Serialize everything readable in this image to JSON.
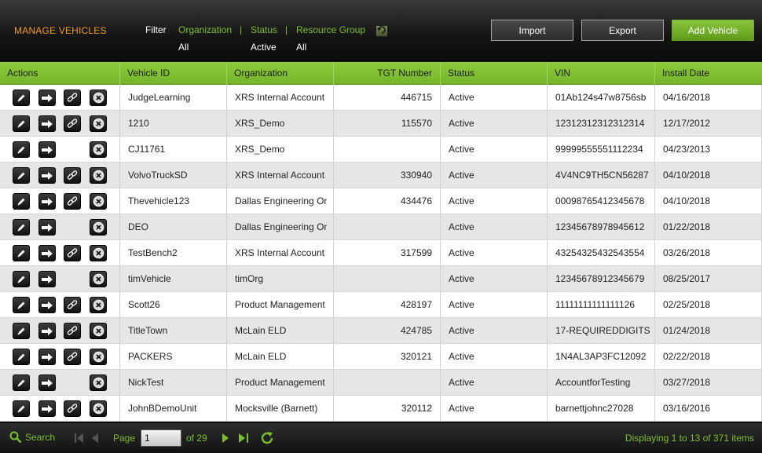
{
  "header": {
    "title": "MANAGE VEHICLES",
    "filter_label": "Filter",
    "filters": [
      {
        "label": "Organization",
        "value": "All"
      },
      {
        "label": "Status",
        "value": "Active"
      },
      {
        "label": "Resource Group",
        "value": "All"
      }
    ],
    "separator": "|",
    "buttons": {
      "import": "Import",
      "export": "Export",
      "add": "Add Vehicle"
    }
  },
  "table": {
    "columns": [
      "Actions",
      "Vehicle ID",
      "Organization",
      "TGT Number",
      "Status",
      "VIN",
      "Install Date"
    ],
    "rows": [
      {
        "vehicle_id": "JudgeLearning",
        "organization": "XRS Internal Account",
        "tgt": "446715",
        "status": "Active",
        "vin": "01Ab124s47w8756sb",
        "install_date": "04/16/2018",
        "has_link": true
      },
      {
        "vehicle_id": "1210",
        "organization": "XRS_Demo",
        "tgt": "115570",
        "status": "Active",
        "vin": "12312312312312314",
        "install_date": "12/17/2012",
        "has_link": true
      },
      {
        "vehicle_id": "CJ11761",
        "organization": "XRS_Demo",
        "tgt": "",
        "status": "Active",
        "vin": "99999555551112234",
        "install_date": "04/23/2013",
        "has_link": false
      },
      {
        "vehicle_id": "VolvoTruckSD",
        "organization": "XRS Internal Account",
        "tgt": "330940",
        "status": "Active",
        "vin": "4V4NC9TH5CN56287",
        "install_date": "04/10/2018",
        "has_link": true
      },
      {
        "vehicle_id": "Thevehicle123",
        "organization": "Dallas Engineering Or",
        "tgt": "434476",
        "status": "Active",
        "vin": "00098765412345678",
        "install_date": "04/10/2018",
        "has_link": true
      },
      {
        "vehicle_id": "DEO",
        "organization": "Dallas Engineering Or",
        "tgt": "",
        "status": "Active",
        "vin": "12345678978945612",
        "install_date": "01/22/2018",
        "has_link": false
      },
      {
        "vehicle_id": "TestBench2",
        "organization": "XRS Internal Account",
        "tgt": "317599",
        "status": "Active",
        "vin": "43254325432543554",
        "install_date": "03/26/2018",
        "has_link": true
      },
      {
        "vehicle_id": "timVehicle",
        "organization": "timOrg",
        "tgt": "",
        "status": "Active",
        "vin": "12345678912345679",
        "install_date": "08/25/2017",
        "has_link": false
      },
      {
        "vehicle_id": "Scott26",
        "organization": "Product Management",
        "tgt": "428197",
        "status": "Active",
        "vin": "11111111111111126",
        "install_date": "02/25/2018",
        "has_link": true
      },
      {
        "vehicle_id": "TitleTown",
        "organization": "McLain ELD",
        "tgt": "424785",
        "status": "Active",
        "vin": "17-REQUIREDDIGITS",
        "install_date": "01/24/2018",
        "has_link": true
      },
      {
        "vehicle_id": "PACKERS",
        "organization": "McLain ELD",
        "tgt": "320121",
        "status": "Active",
        "vin": "1N4AL3AP3FC12092",
        "install_date": "02/22/2018",
        "has_link": true
      },
      {
        "vehicle_id": "NickTest",
        "organization": "Product Management",
        "tgt": "",
        "status": "Active",
        "vin": "AccountforTesting",
        "install_date": "03/27/2018",
        "has_link": false
      },
      {
        "vehicle_id": "JohnBDemoUnit",
        "organization": "Mocksville (Barnett)",
        "tgt": "320112",
        "status": "Active",
        "vin": "barnettjohnc27028",
        "install_date": "03/16/2016",
        "has_link": true
      }
    ]
  },
  "footer": {
    "search_label": "Search",
    "page_label": "Page",
    "page_value": "1",
    "of_label": "of 29",
    "display_text": "Displaying 1 to 13 of 371 items"
  },
  "icons": {
    "edit": "pencil-icon",
    "go": "arrow-right-icon",
    "link": "chain-link-icon",
    "delete": "circle-x-icon",
    "search": "magnifier-icon",
    "first": "first-page-icon",
    "prev": "prev-page-icon",
    "next": "next-page-icon",
    "last": "last-page-icon",
    "refresh": "refresh-icon",
    "reset": "reset-filter-icon"
  },
  "colors": {
    "accent_green": "#7cbf2e",
    "title_orange": "#f29b1d",
    "header_green": "#80c232"
  }
}
